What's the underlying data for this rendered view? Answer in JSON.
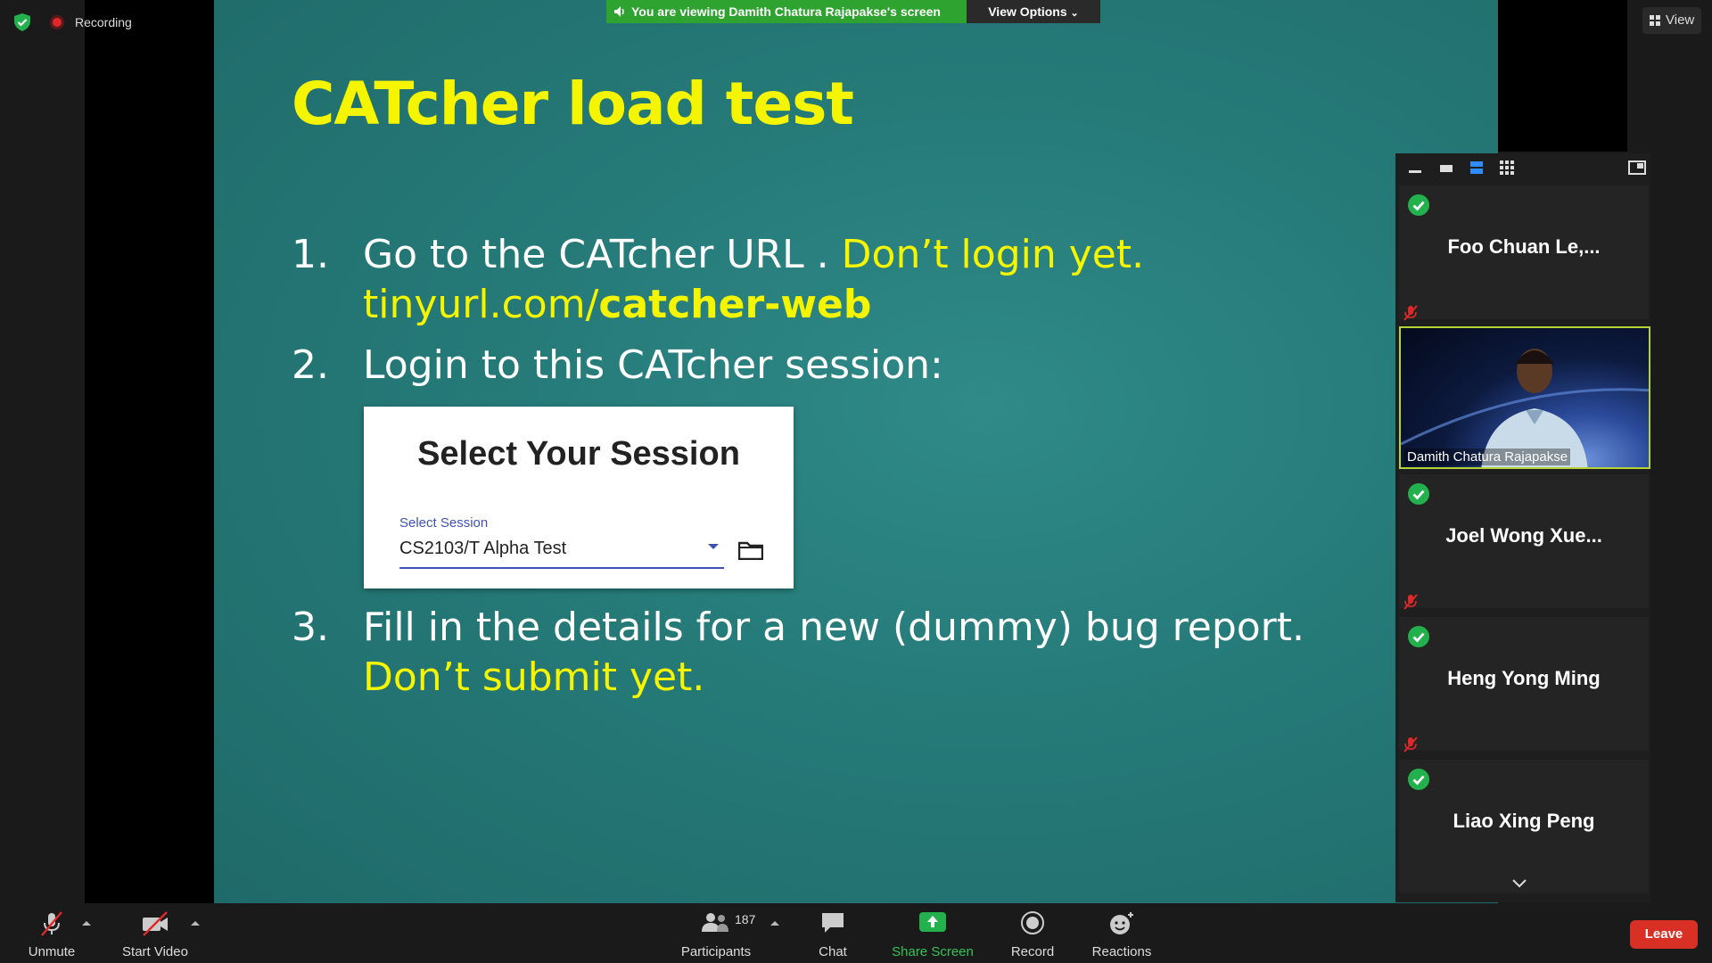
{
  "top_bar": {
    "recording_label": "Recording",
    "viewing_banner": "You are viewing Damith Chatura Rajapakse's screen",
    "view_options_label": "View Options",
    "view_label": "View"
  },
  "slide": {
    "title": "CATcher load test",
    "items": [
      {
        "num": "1.",
        "text": "Go to the CATcher URL . ",
        "highlight": "Don’t login yet."
      },
      {
        "num": "2.",
        "text": "Login to this CATcher session:"
      },
      {
        "num": "3.",
        "text": "Fill in the details for a new (dummy) bug report."
      }
    ],
    "url_prefix": "tinyurl.com/",
    "url_bold": "catcher-web",
    "item3_continuation": "Don’t submit yet.",
    "session_card": {
      "title": "Select Your Session",
      "select_label": "Select Session",
      "select_value": "CS2103/T Alpha Test"
    }
  },
  "participants_panel": {
    "tiles": [
      {
        "name": "Foo Chuan Le,..."
      },
      {
        "name": "Joel Wong Xue..."
      },
      {
        "name": "Heng Yong Ming"
      },
      {
        "name": "Liao Xing Peng"
      }
    ],
    "video_name": "Damith Chatura Rajapakse"
  },
  "toolbar": {
    "unmute": "Unmute",
    "start_video": "Start Video",
    "participants": "Participants",
    "participants_count": "187",
    "chat": "Chat",
    "share_screen": "Share Screen",
    "record": "Record",
    "reactions": "Reactions",
    "leave": "Leave"
  },
  "colors": {
    "slide_bg": "#257a78",
    "slide_yellow": "#f5f500",
    "banner_green": "#2fa32f",
    "leave_red": "#d93025",
    "check_green": "#23b14d",
    "share_green": "#23b14d"
  }
}
